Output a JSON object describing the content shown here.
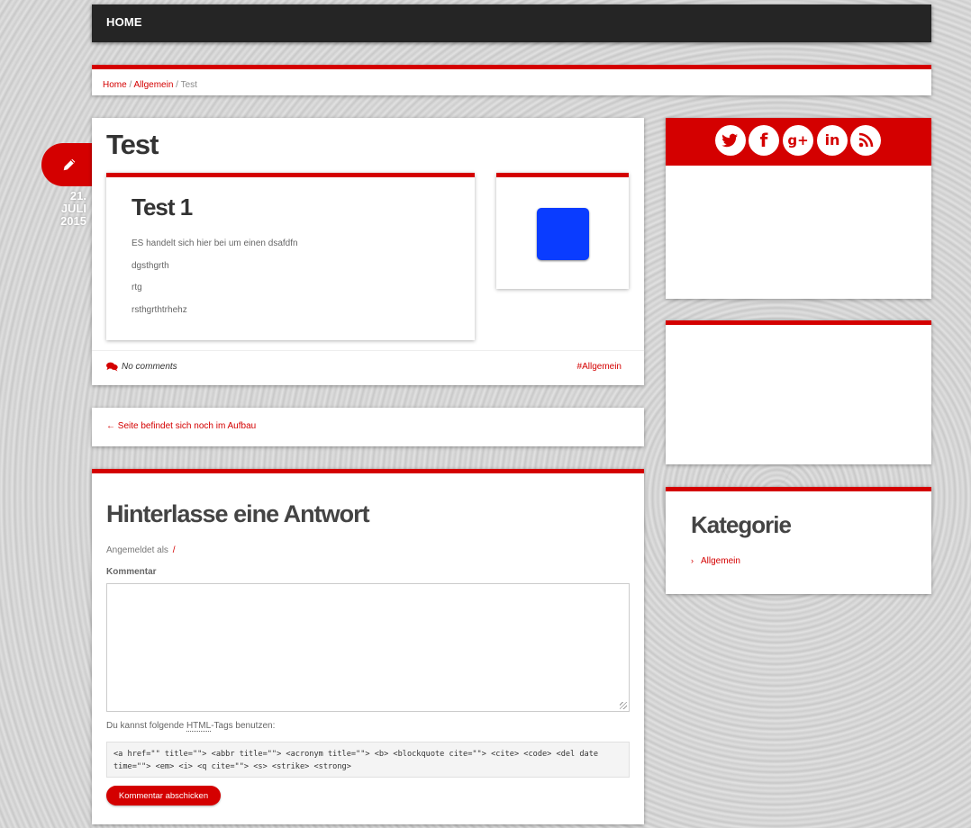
{
  "nav": {
    "home_label": "HOME"
  },
  "breadcrumb": {
    "home": "Home",
    "sep1": " / ",
    "category": "Allgemein",
    "sep2": " / ",
    "current": "Test"
  },
  "date_badge": {
    "day": "21.",
    "month": "JULI",
    "year": "2015",
    "icon": "pencil-icon"
  },
  "post": {
    "title": "Test",
    "card": {
      "title": "Test 1",
      "paragraphs": [
        "ES handelt sich hier bei um einen dsafdfn",
        "dgsthgrth",
        "rtg",
        "rsthgrthtrhehz"
      ]
    },
    "comments_label": "No comments",
    "category_tag": "#Allgemein"
  },
  "prev_nav": {
    "label": "← Seite befindet sich noch im Aufbau"
  },
  "reply": {
    "title": "Hinterlasse eine Antwort",
    "logged_in_prefix": "Angemeldet als",
    "logged_in_user": "/",
    "comment_label": "Kommentar",
    "comment_value": "",
    "allowed_prefix": "Du kannst folgende ",
    "allowed_abbr": "HTML",
    "allowed_suffix": "-Tags benutzen:",
    "allowed_tags": "<a href=\"\" title=\"\"> <abbr title=\"\"> <acronym title=\"\"> <b> <blockquote cite=\"\"> <cite> <code> <del date time=\"\"> <em> <i> <q cite=\"\"> <s> <strike> <strong>",
    "submit_label": "Kommentar abschicken"
  },
  "sidebar": {
    "social": {
      "twitter": "t",
      "facebook": "f",
      "googleplus": "g+",
      "linkedin": "in",
      "rss": ""
    },
    "categories": {
      "title": "Kategorie",
      "items": [
        "Allgemein"
      ]
    }
  },
  "colors": {
    "accent": "#d40000",
    "navbar": "#252525",
    "thumb": "#0a3cff"
  }
}
